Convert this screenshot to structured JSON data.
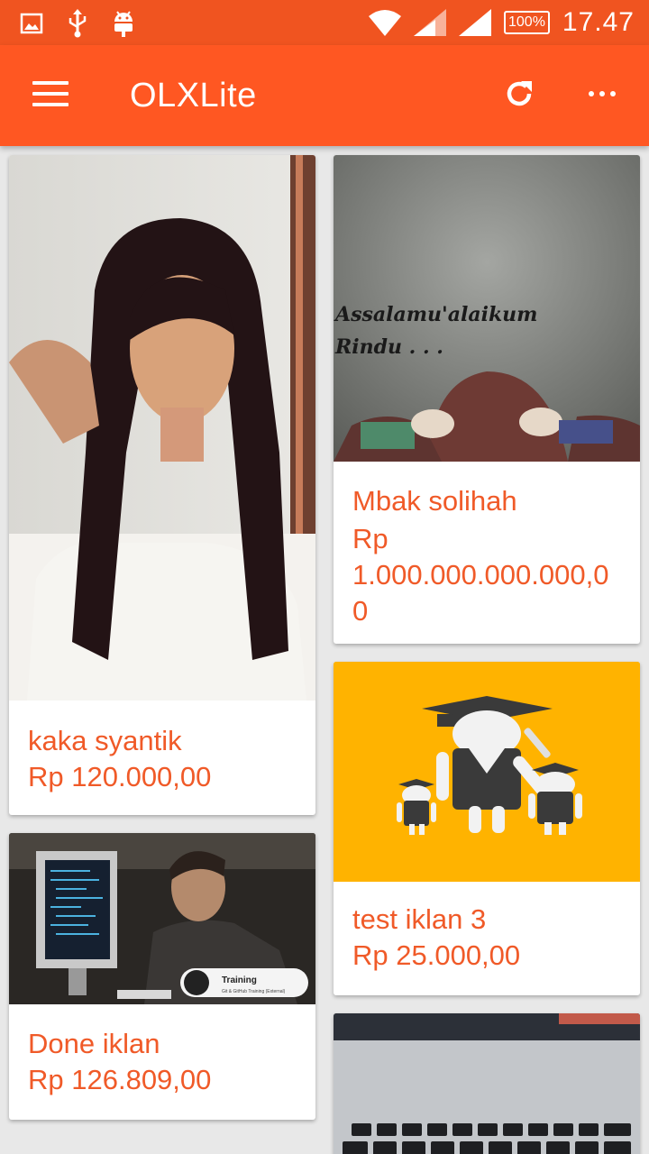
{
  "status_bar": {
    "battery": "100%",
    "time": "17.47",
    "icons": [
      "image-icon",
      "usb-icon",
      "android-icon",
      "wifi-icon",
      "signal-icon",
      "signal-icon",
      "battery-icon"
    ]
  },
  "app_bar": {
    "title": "OLXLite",
    "icons": [
      "menu-icon",
      "refresh-icon",
      "more-icon"
    ]
  },
  "image_texts": {
    "card2_line1": "Assalamu'alaikum",
    "card2_line2": "Rindu . . .",
    "card3_badge_title": "Training",
    "card3_badge_sub": "Git & GitHub Training (External)"
  },
  "listings": [
    {
      "title": "kaka syantik",
      "price": "Rp 120.000,00"
    },
    {
      "title": "Mbak solihah",
      "price": "Rp\n1.000.000.000.000,0\n0"
    },
    {
      "title": "test iklan 3",
      "price": "Rp 25.000,00"
    },
    {
      "title": "Done iklan",
      "price": "Rp 126.809,00"
    },
    {
      "title": "",
      "price": ""
    }
  ],
  "colors": {
    "status_bar": "#f05420",
    "app_bar": "#ff5722",
    "listing_text": "#f05a28",
    "background": "#e8e8e8"
  }
}
